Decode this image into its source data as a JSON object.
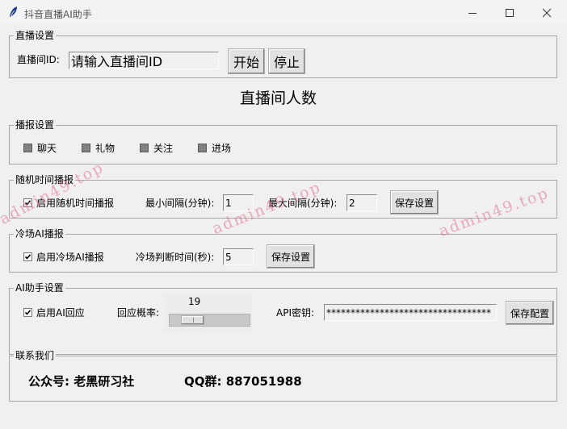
{
  "window": {
    "title": "抖音直播AI助手",
    "minimize_icon": "minimize-icon",
    "maximize_icon": "maximize-icon",
    "close_icon": "close-icon"
  },
  "live_settings": {
    "group_title": "直播设置",
    "room_id_label": "直播间ID:",
    "room_id_value": "请输入直播间ID",
    "start_label": "开始",
    "stop_label": "停止"
  },
  "viewer_count_label": "直播间人数",
  "broadcast_settings": {
    "group_title": "播报设置",
    "options": [
      {
        "label": "聊天",
        "checked": false
      },
      {
        "label": "礼物",
        "checked": false
      },
      {
        "label": "关注",
        "checked": false
      },
      {
        "label": "进场",
        "checked": false
      }
    ]
  },
  "random_broadcast": {
    "group_title": "随机时间播报",
    "enable_label": "启用随机时间播报",
    "enabled": true,
    "min_label": "最小间隔(分钟):",
    "min_value": "1",
    "max_label": "最大间隔(分钟):",
    "max_value": "2",
    "save_label": "保存设置"
  },
  "cold_broadcast": {
    "group_title": "冷场AI播报",
    "enable_label": "启用冷场AI播报",
    "enabled": true,
    "threshold_label": "冷场判断时间(秒):",
    "threshold_value": "5",
    "save_label": "保存设置"
  },
  "ai_settings": {
    "group_title": "AI助手设置",
    "enable_label": "启用AI回应",
    "enabled": true,
    "prob_label": "回应概率:",
    "prob_value": "19",
    "prob_fraction": 0.19,
    "api_label": "API密钥:",
    "api_value": "**********************************",
    "save_label": "保存配置"
  },
  "contact": {
    "group_title": "联系我们",
    "wechat": "公众号: 老黑研习社",
    "qq": "QQ群: 887051988"
  },
  "watermark_text": "admin49.top",
  "colors": {
    "watermark": "#e66e8c",
    "checkbox_unchecked": "#808080"
  }
}
